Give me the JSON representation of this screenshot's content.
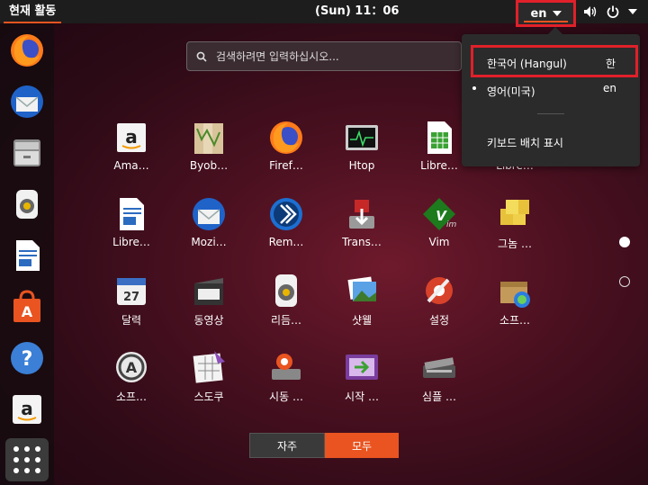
{
  "topbar": {
    "activities": "현재 활동",
    "clock": "(Sun) 11：06",
    "input_lang": "en"
  },
  "search": {
    "placeholder": "검색하려면 입력하십시오..."
  },
  "dock": {
    "items": [
      "firefox-icon",
      "thunderbird-icon",
      "files-icon",
      "rhythmbox-icon",
      "writer-icon",
      "software-icon",
      "help-icon",
      "amazon-icon"
    ]
  },
  "apps": [
    {
      "label": "Ama…",
      "icon": "amazon-icon"
    },
    {
      "label": "Byob…",
      "icon": "byobu-icon"
    },
    {
      "label": "Firef…",
      "icon": "firefox-icon"
    },
    {
      "label": "Htop",
      "icon": "htop-icon"
    },
    {
      "label": "Libre…",
      "icon": "calc-icon"
    },
    {
      "label": "Libre…",
      "icon": "impress-icon"
    },
    {
      "label": "Libre…",
      "icon": "writer-icon"
    },
    {
      "label": "Mozi…",
      "icon": "thunderbird-icon"
    },
    {
      "label": "Rem…",
      "icon": "remmina-icon"
    },
    {
      "label": "Trans…",
      "icon": "transmission-icon"
    },
    {
      "label": "Vim",
      "icon": "vim-icon"
    },
    {
      "label": "그놈 …",
      "icon": "mahjongg-icon"
    },
    {
      "label": "달력",
      "icon": "calendar-icon"
    },
    {
      "label": "동영상",
      "icon": "video-icon"
    },
    {
      "label": "리듬…",
      "icon": "rhythmbox-icon"
    },
    {
      "label": "샷웰",
      "icon": "shotwell-icon"
    },
    {
      "label": "설정",
      "icon": "settings-icon"
    },
    {
      "label": "소프…",
      "icon": "software-properties-icon"
    },
    {
      "label": "소프…",
      "icon": "software-updater-icon"
    },
    {
      "label": "스도쿠",
      "icon": "sudoku-icon"
    },
    {
      "label": "시동 …",
      "icon": "startup-disk-icon"
    },
    {
      "label": "시작 …",
      "icon": "startup-apps-icon"
    },
    {
      "label": "심플 …",
      "icon": "scanner-icon"
    }
  ],
  "tabs": {
    "frequent": "자주",
    "all": "모두"
  },
  "menu": {
    "item1_label": "한국어 (Hangul)",
    "item1_key": "한",
    "item2_label": "영어(미국)",
    "item2_key": "en",
    "item3_label": "키보드 배치 표시"
  },
  "colors": {
    "accent": "#e95420",
    "highlight": "#e0202a"
  }
}
